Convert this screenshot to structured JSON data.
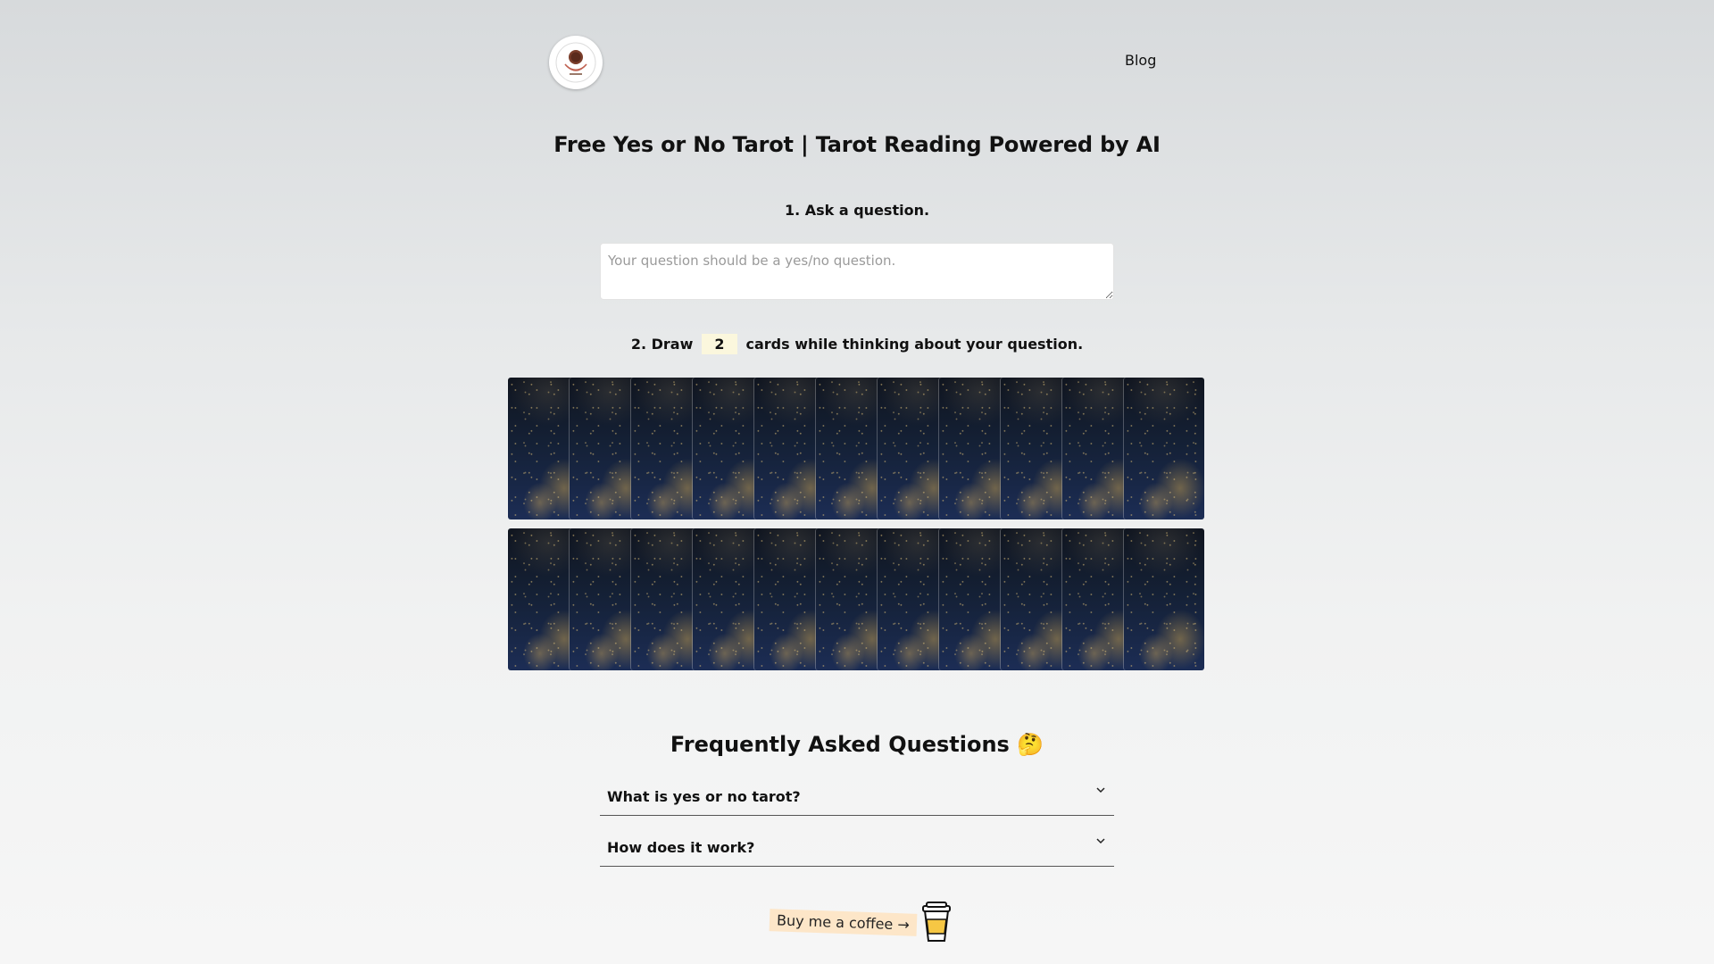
{
  "header": {
    "blog_label": "Blog"
  },
  "title": "Free Yes or No Tarot | Tarot Reading Powered by AI",
  "step1": {
    "label": "1. Ask a question.",
    "placeholder": "Your question should be a yes/no question."
  },
  "step2": {
    "prefix": "2. Draw",
    "count": "2",
    "suffix": "cards while thinking about your question."
  },
  "deck": {
    "rows": 2,
    "cards_per_row": 11,
    "card_back_colors": [
      "#10151f",
      "#1c2d55",
      "#b8964e"
    ]
  },
  "faq": {
    "title": "Frequently Asked Questions 🤔",
    "items": [
      {
        "question": "What is yes or no tarot?"
      },
      {
        "question": "How does it work?"
      }
    ]
  },
  "coffee": {
    "label": "Buy me a coffee →"
  },
  "icons": {
    "logo": "tarot-reader-logo",
    "chevron": "chevron-down-icon",
    "coffee": "coffee-cup-icon"
  }
}
